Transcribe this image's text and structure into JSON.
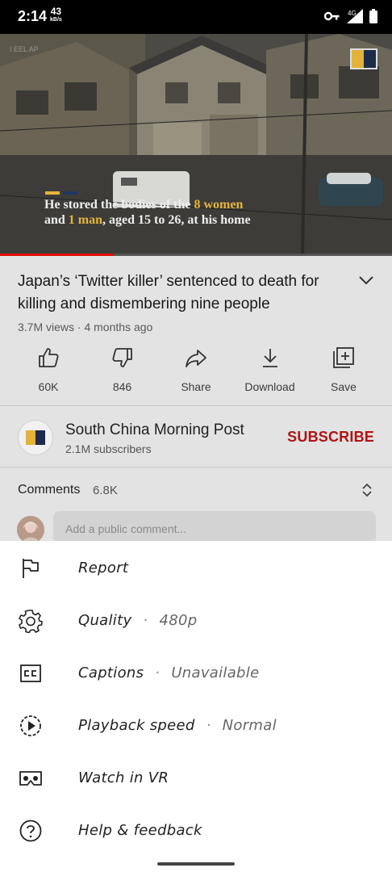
{
  "status_bar": {
    "time": "2:14",
    "speed_value": "43",
    "speed_unit": "kB/s",
    "network": "4G"
  },
  "video": {
    "watermark": "I EEL AP",
    "caption": {
      "part1": "He stored the bodies of the ",
      "highlight1": "8 women",
      "part2": "and ",
      "highlight2": "1 man",
      "part3": ", aged 15 to 26, at his home"
    },
    "progress_fraction": 0.29
  },
  "details": {
    "title": "Japan’s ‘Twitter killer’ sentenced to death for killing and dismembering nine people",
    "meta": "3.7M views · 4 months ago",
    "actions": [
      {
        "icon": "thumbs-up-icon",
        "label": "60K"
      },
      {
        "icon": "thumbs-down-icon",
        "label": "846"
      },
      {
        "icon": "share-icon",
        "label": "Share"
      },
      {
        "icon": "download-icon",
        "label": "Download"
      },
      {
        "icon": "save-to-playlist-icon",
        "label": "Save"
      }
    ]
  },
  "channel": {
    "name": "South China Morning Post",
    "subscribers": "2.1M subscribers",
    "subscribe_label": "SUBSCRIBE"
  },
  "comments": {
    "label": "Comments",
    "count": "6.8K",
    "placeholder": "Add a public comment..."
  },
  "menu": {
    "report": "Report",
    "quality_label": "Quality",
    "quality_value": "480p",
    "captions_label": "Captions",
    "captions_value": "Unavailable",
    "speed_label": "Playback speed",
    "speed_value": "Normal",
    "vr_label": "Watch in VR",
    "help_label": "Help & feedback",
    "separator": "·"
  },
  "colors": {
    "subscribe": "#b31212",
    "caption_highlight": "#e5b43a",
    "progress": "#ee0000"
  }
}
